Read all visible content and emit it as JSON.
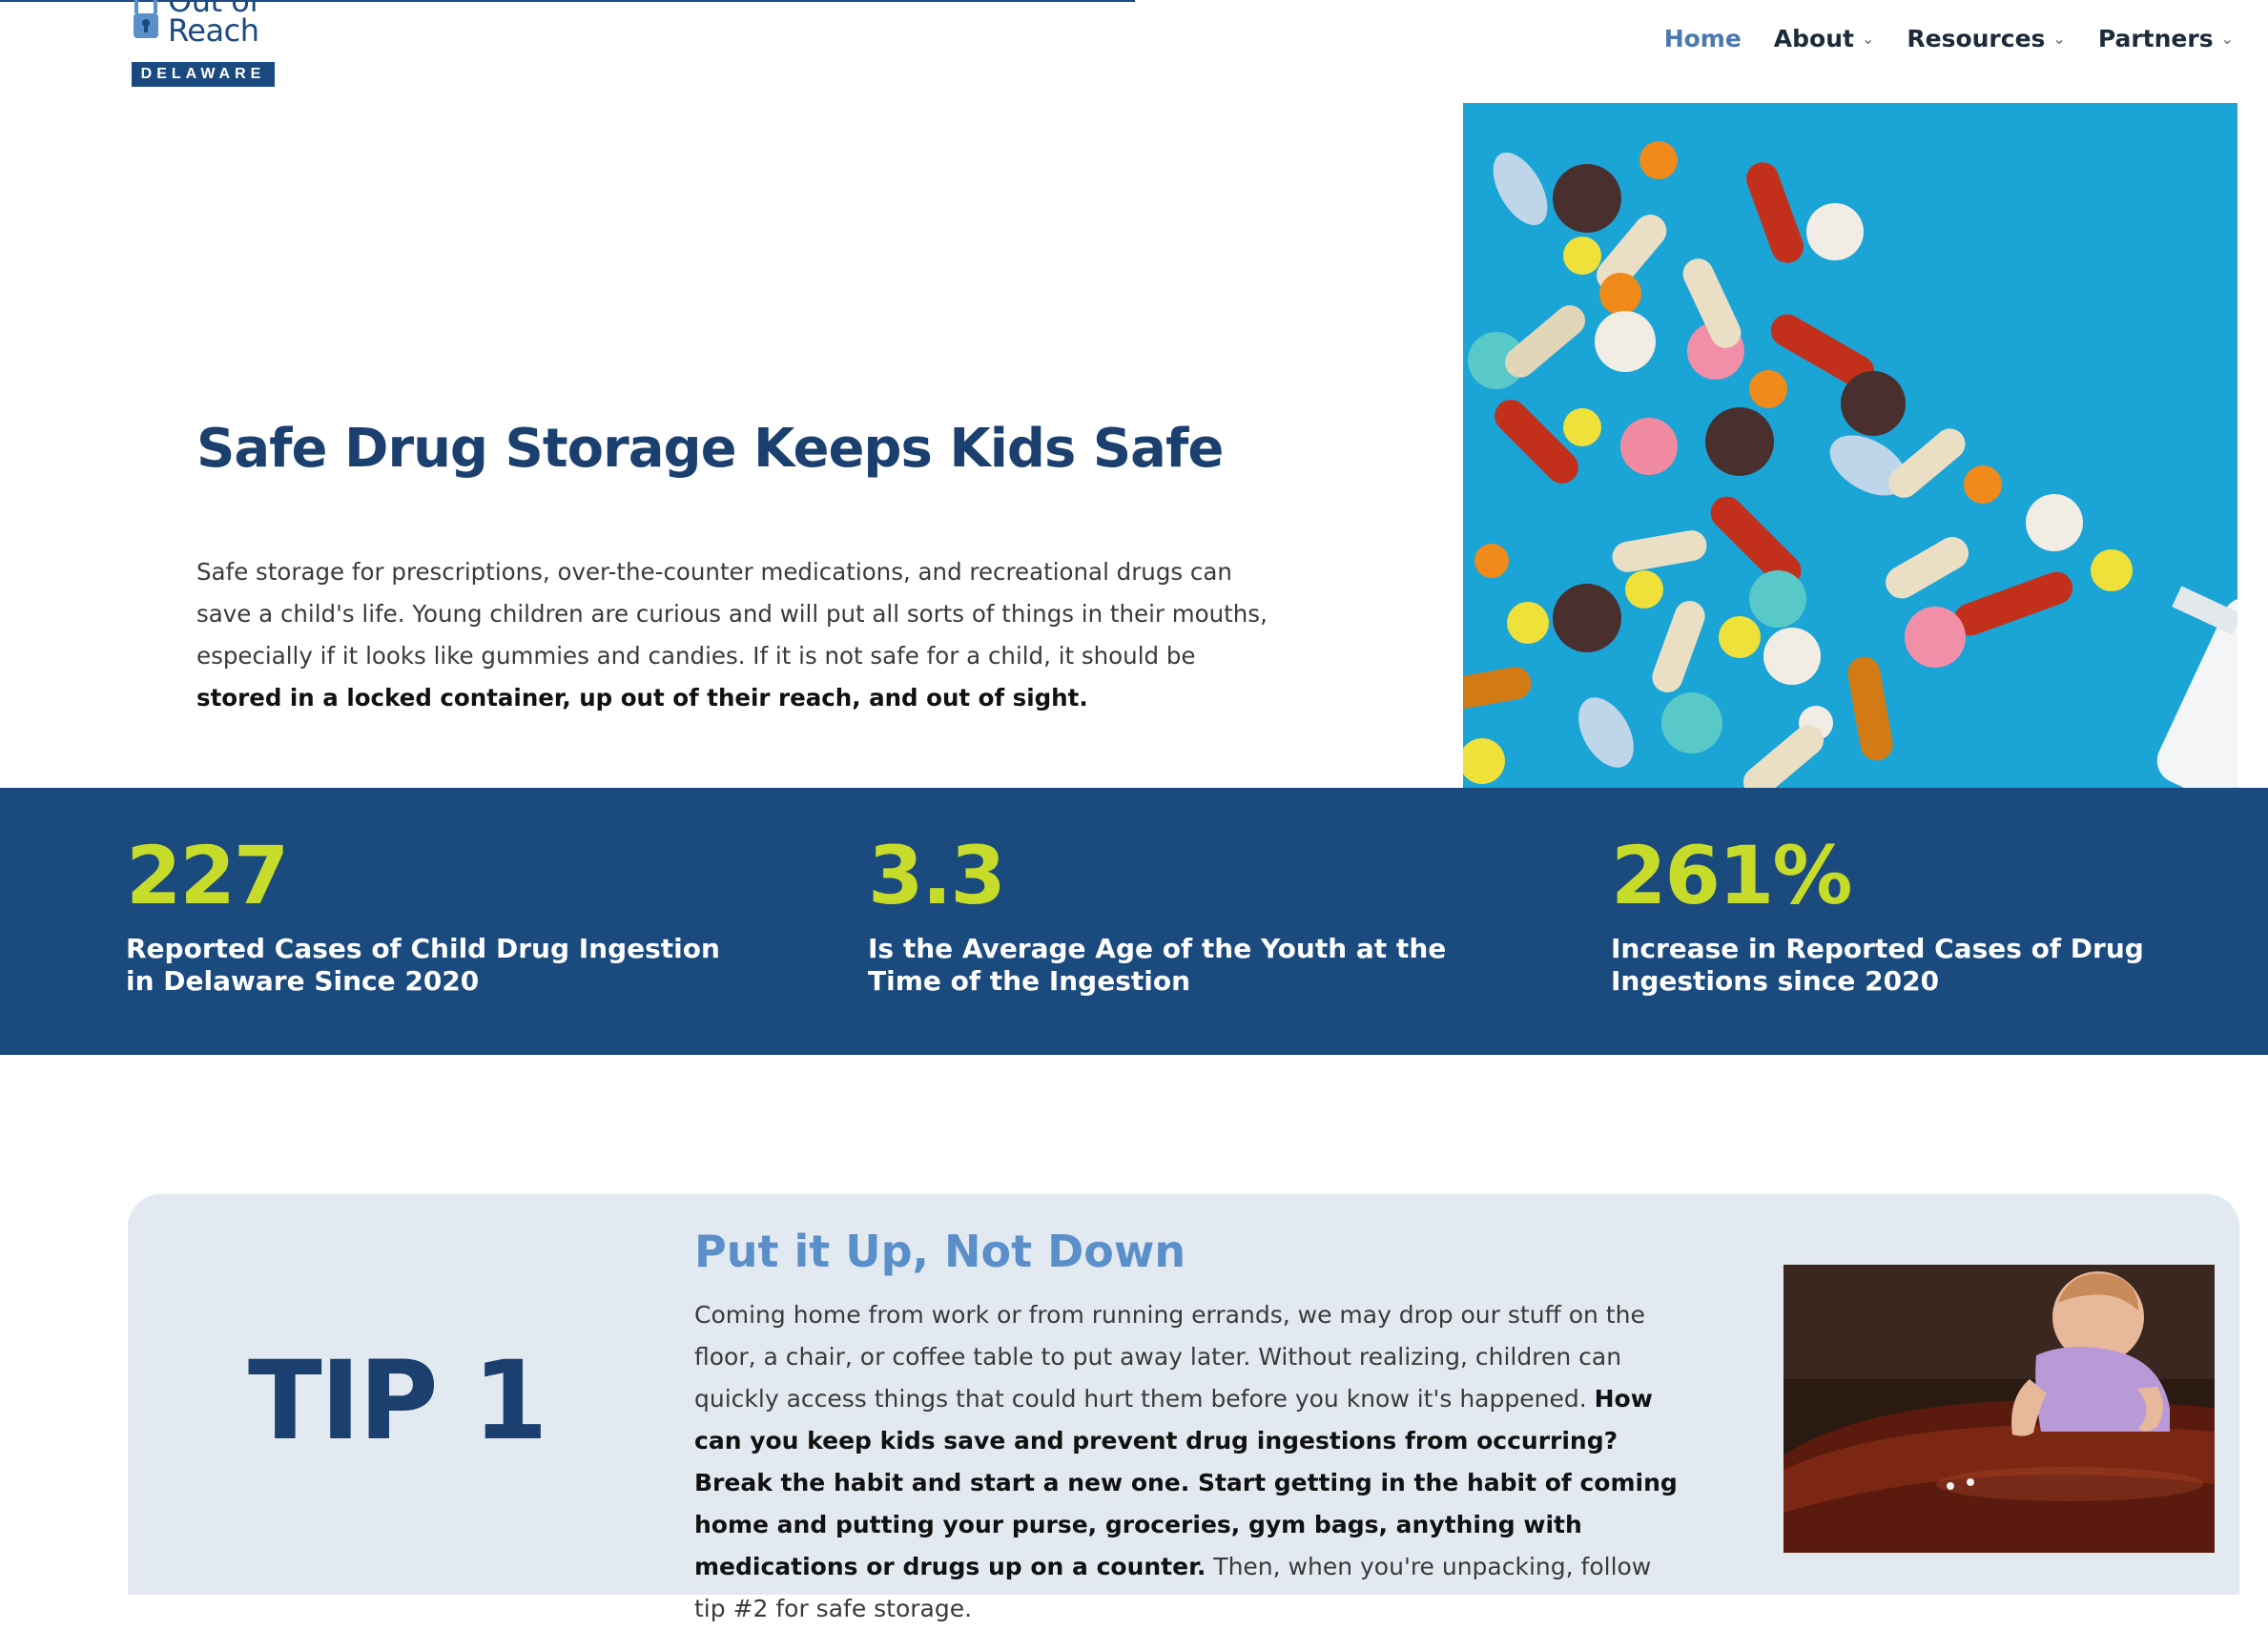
{
  "header": {
    "logo": {
      "line1": "Out of",
      "line2": "Reach",
      "band": "DELAWARE"
    },
    "nav": [
      {
        "label": "Home",
        "active": true,
        "dropdown": false
      },
      {
        "label": "About",
        "active": false,
        "dropdown": true
      },
      {
        "label": "Resources",
        "active": false,
        "dropdown": true
      },
      {
        "label": "Partners",
        "active": false,
        "dropdown": true
      }
    ]
  },
  "hero": {
    "title": "Safe Drug Storage Keeps Kids Safe",
    "text": "Safe storage for prescriptions, over-the-counter medications, and recreational drugs can save a child's life. Young children are curious and will put all sorts of things in their mouths, especially if it looks like gummies and candies. If it is not safe for a child, it should be ",
    "text_bold": "stored in a locked container, up out of their reach, and out of sight."
  },
  "stats": [
    {
      "number": "227",
      "label": "Reported Cases of Child Drug Ingestion in Delaware Since 2020"
    },
    {
      "number": "3.3",
      "label": "Is the Average Age of the Youth at the Time of the Ingestion"
    },
    {
      "number": "261%",
      "label": "Increase in Reported Cases of Drug Ingestions since 2020"
    }
  ],
  "tip": {
    "label": "TIP 1",
    "title": "Put it Up, Not Down",
    "text": "Coming home from work or from running errands, we may drop our stuff on the floor, a chair, or coffee table to put away later. Without realizing, children can quickly access things that could hurt them before you know it's happened. ",
    "text_bold": "How can you keep kids save and prevent drug ingestions from occurring? Break the habit and start a new one. Start getting in the habit of coming home and putting your purse, groceries, gym bags, anything with medications or drugs up on a counter.",
    "text_after": " Then, when you're unpacking, follow tip #2 for safe storage."
  },
  "colors": {
    "brand_navy": "#1b4a7e",
    "accent_lime": "#c7dc2a",
    "accent_blue": "#5b8fca",
    "card_bg": "#e3e9f0"
  }
}
